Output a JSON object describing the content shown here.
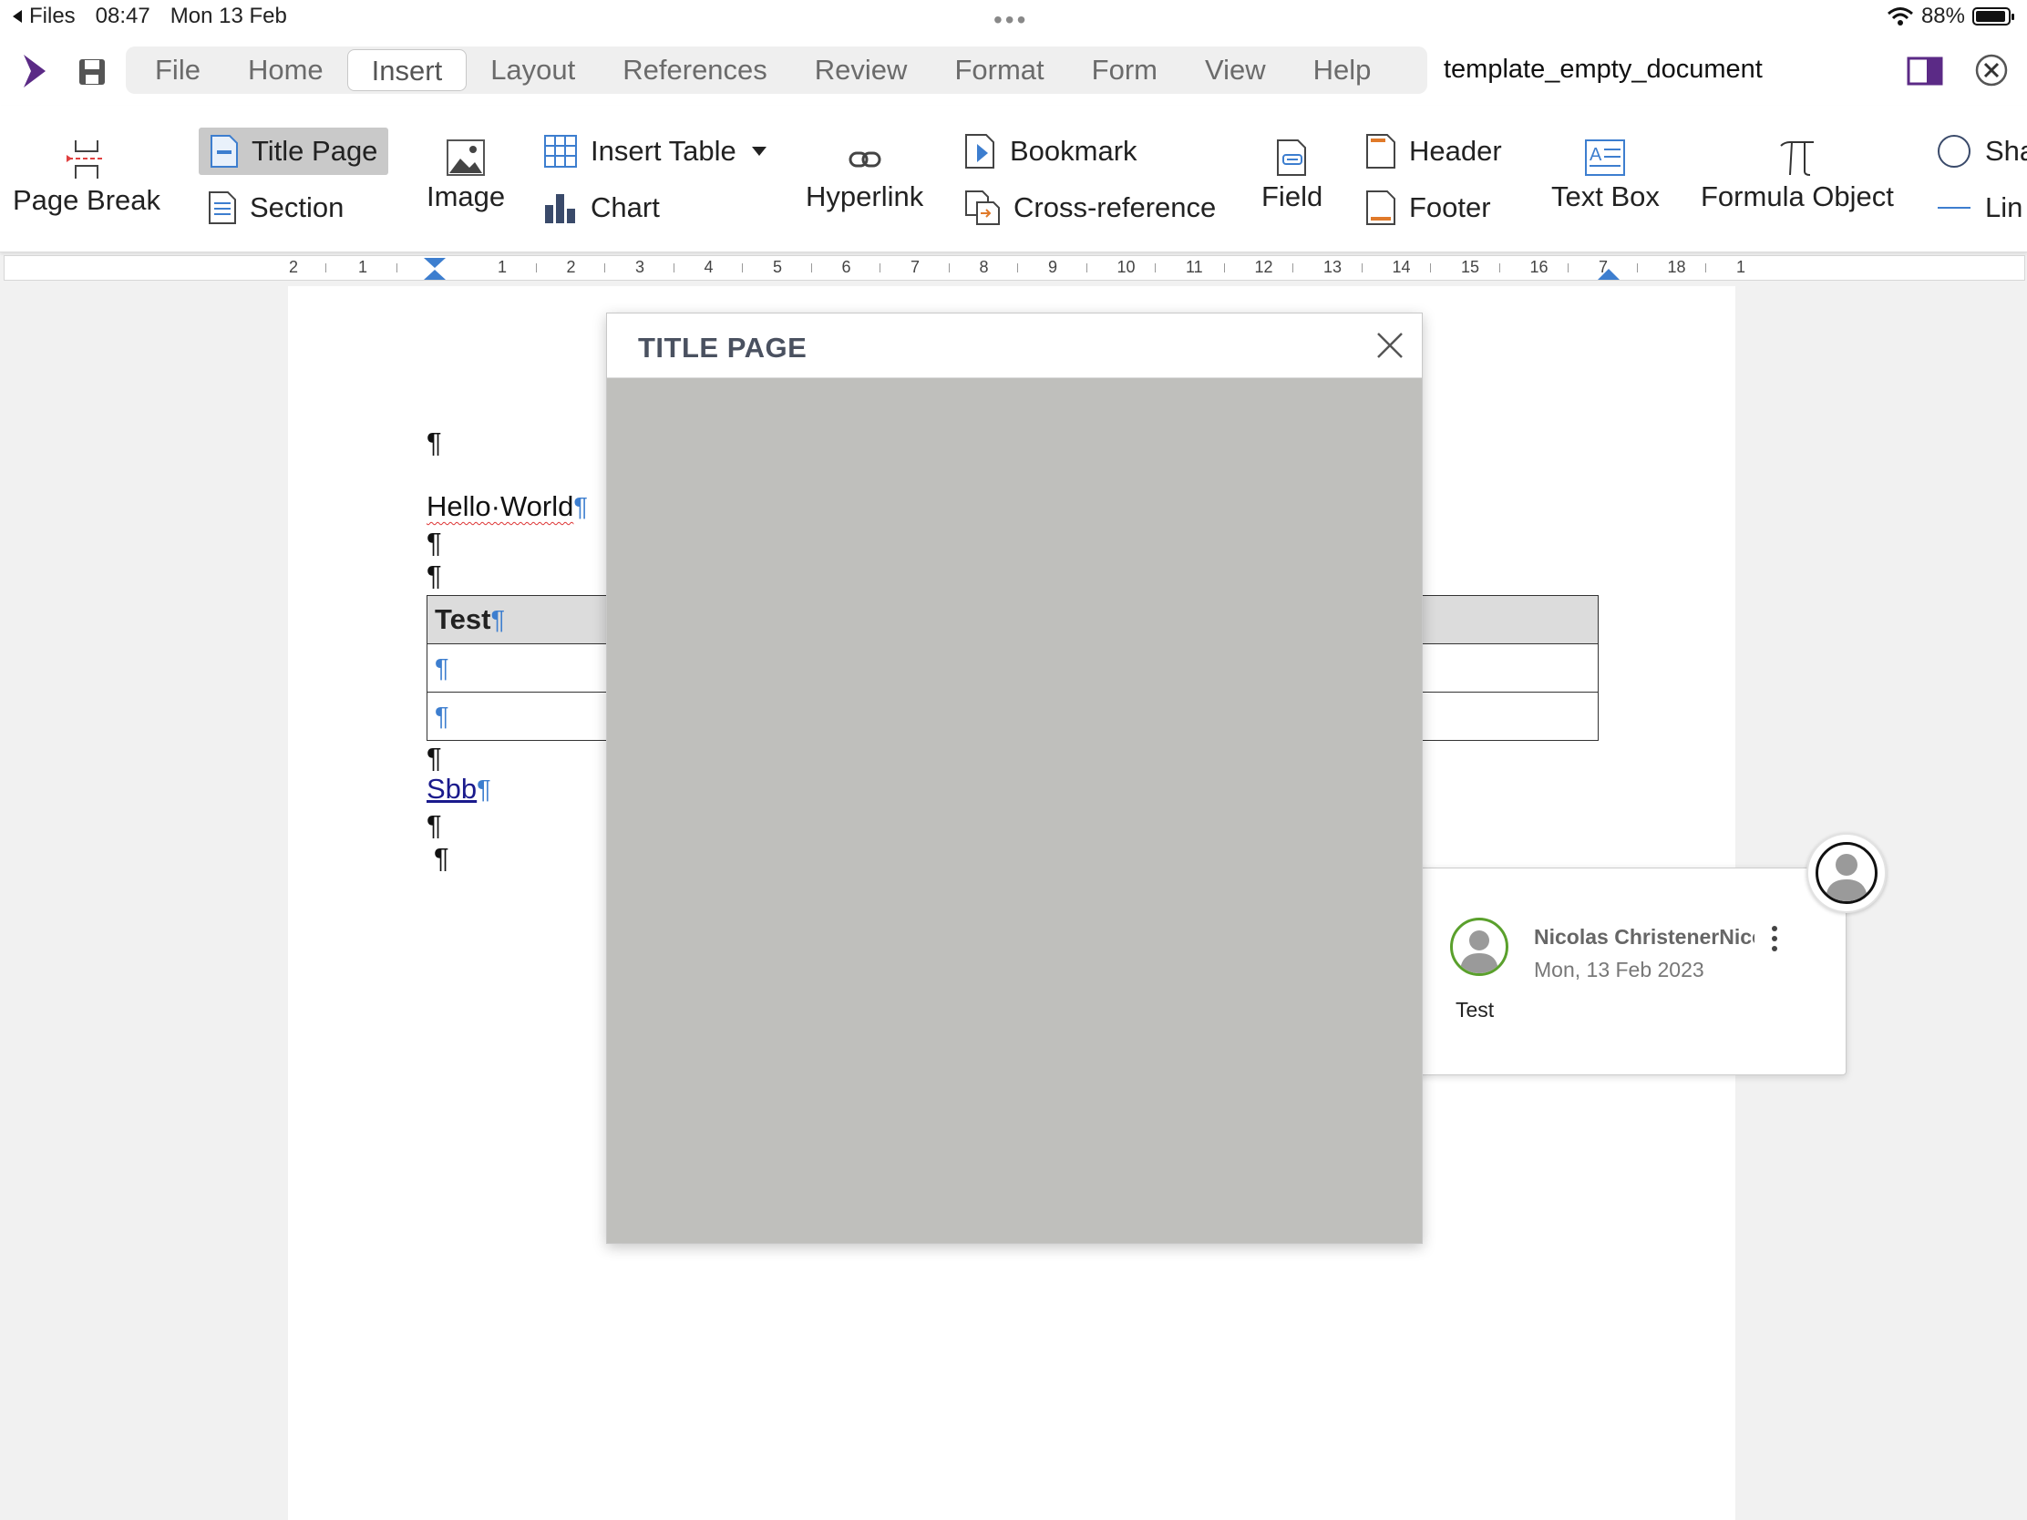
{
  "status_bar": {
    "back_label": "Files",
    "time": "08:47",
    "date": "Mon 13 Feb",
    "battery": "88%"
  },
  "menu": {
    "items": [
      "File",
      "Home",
      "Insert",
      "Layout",
      "References",
      "Review",
      "Format",
      "Form",
      "View",
      "Help"
    ],
    "active": "Insert",
    "document_title": "template_empty_document"
  },
  "ribbon": {
    "page_break": "Page Break",
    "title_page": "Title Page",
    "section": "Section",
    "image": "Image",
    "insert_table": "Insert Table",
    "chart": "Chart",
    "hyperlink": "Hyperlink",
    "bookmark": "Bookmark",
    "cross_reference": "Cross-reference",
    "field": "Field",
    "header": "Header",
    "footer": "Footer",
    "text_box": "Text Box",
    "formula_object": "Formula Object",
    "shape": "Sha",
    "line": "Lin"
  },
  "ruler": {
    "labels": [
      "2",
      "1",
      "1",
      "2",
      "3",
      "4",
      "5",
      "6",
      "7",
      "8",
      "9",
      "10",
      "11",
      "12",
      "13",
      "14",
      "15",
      "16",
      "7",
      "18",
      "1"
    ]
  },
  "document": {
    "pilcrow": "¶",
    "hello": "Hello·World",
    "table_header": "Test",
    "link_text": "Sbb"
  },
  "comment": {
    "author": "Nicolas ChristenerNicolas Christener",
    "date": "Mon, 13 Feb 2023",
    "text": "Test"
  },
  "dialog": {
    "title": "TITLE PAGE"
  },
  "colors": {
    "accent_purple": "#5b2a86",
    "pilcrow_blue": "#3d7ecf",
    "avatar_green": "#5aa02c",
    "dialog_body_gray": "#bfbfbc"
  }
}
